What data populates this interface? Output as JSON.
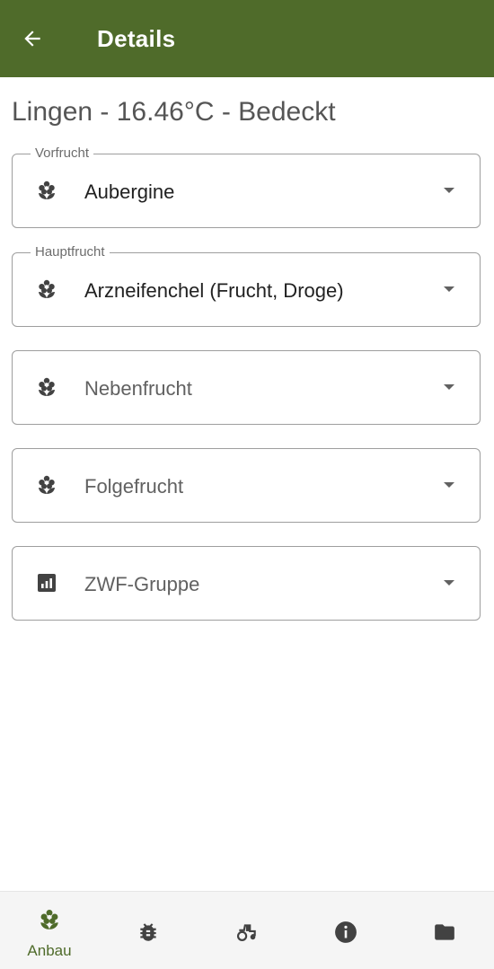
{
  "theme": {
    "primary": "#4f6b2a",
    "icon_dark": "#424242"
  },
  "app_bar": {
    "title": "Details",
    "back_icon": "arrow-left-icon"
  },
  "weather": {
    "text": "Lingen - 16.46°C - Bedeckt"
  },
  "fields": {
    "vorfrucht": {
      "label": "Vorfrucht",
      "value": "Aubergine",
      "icon": "flower-icon"
    },
    "hauptfrucht": {
      "label": "Hauptfrucht",
      "value": "Arzneifenchel (Frucht, Droge)",
      "icon": "flower-icon"
    },
    "nebenfrucht": {
      "placeholder": "Nebenfrucht",
      "icon": "flower-icon"
    },
    "folgefrucht": {
      "placeholder": "Folgefrucht",
      "icon": "flower-icon"
    },
    "zwf_gruppe": {
      "placeholder": "ZWF-Gruppe",
      "icon": "chart-icon"
    }
  },
  "bottom_nav": {
    "items": [
      {
        "label": "Anbau",
        "icon": "flower-icon",
        "active": true
      },
      {
        "label": "",
        "icon": "bug-icon",
        "active": false
      },
      {
        "label": "",
        "icon": "tractor-icon",
        "active": false
      },
      {
        "label": "",
        "icon": "info-icon",
        "active": false
      },
      {
        "label": "",
        "icon": "folder-icon",
        "active": false
      }
    ]
  }
}
